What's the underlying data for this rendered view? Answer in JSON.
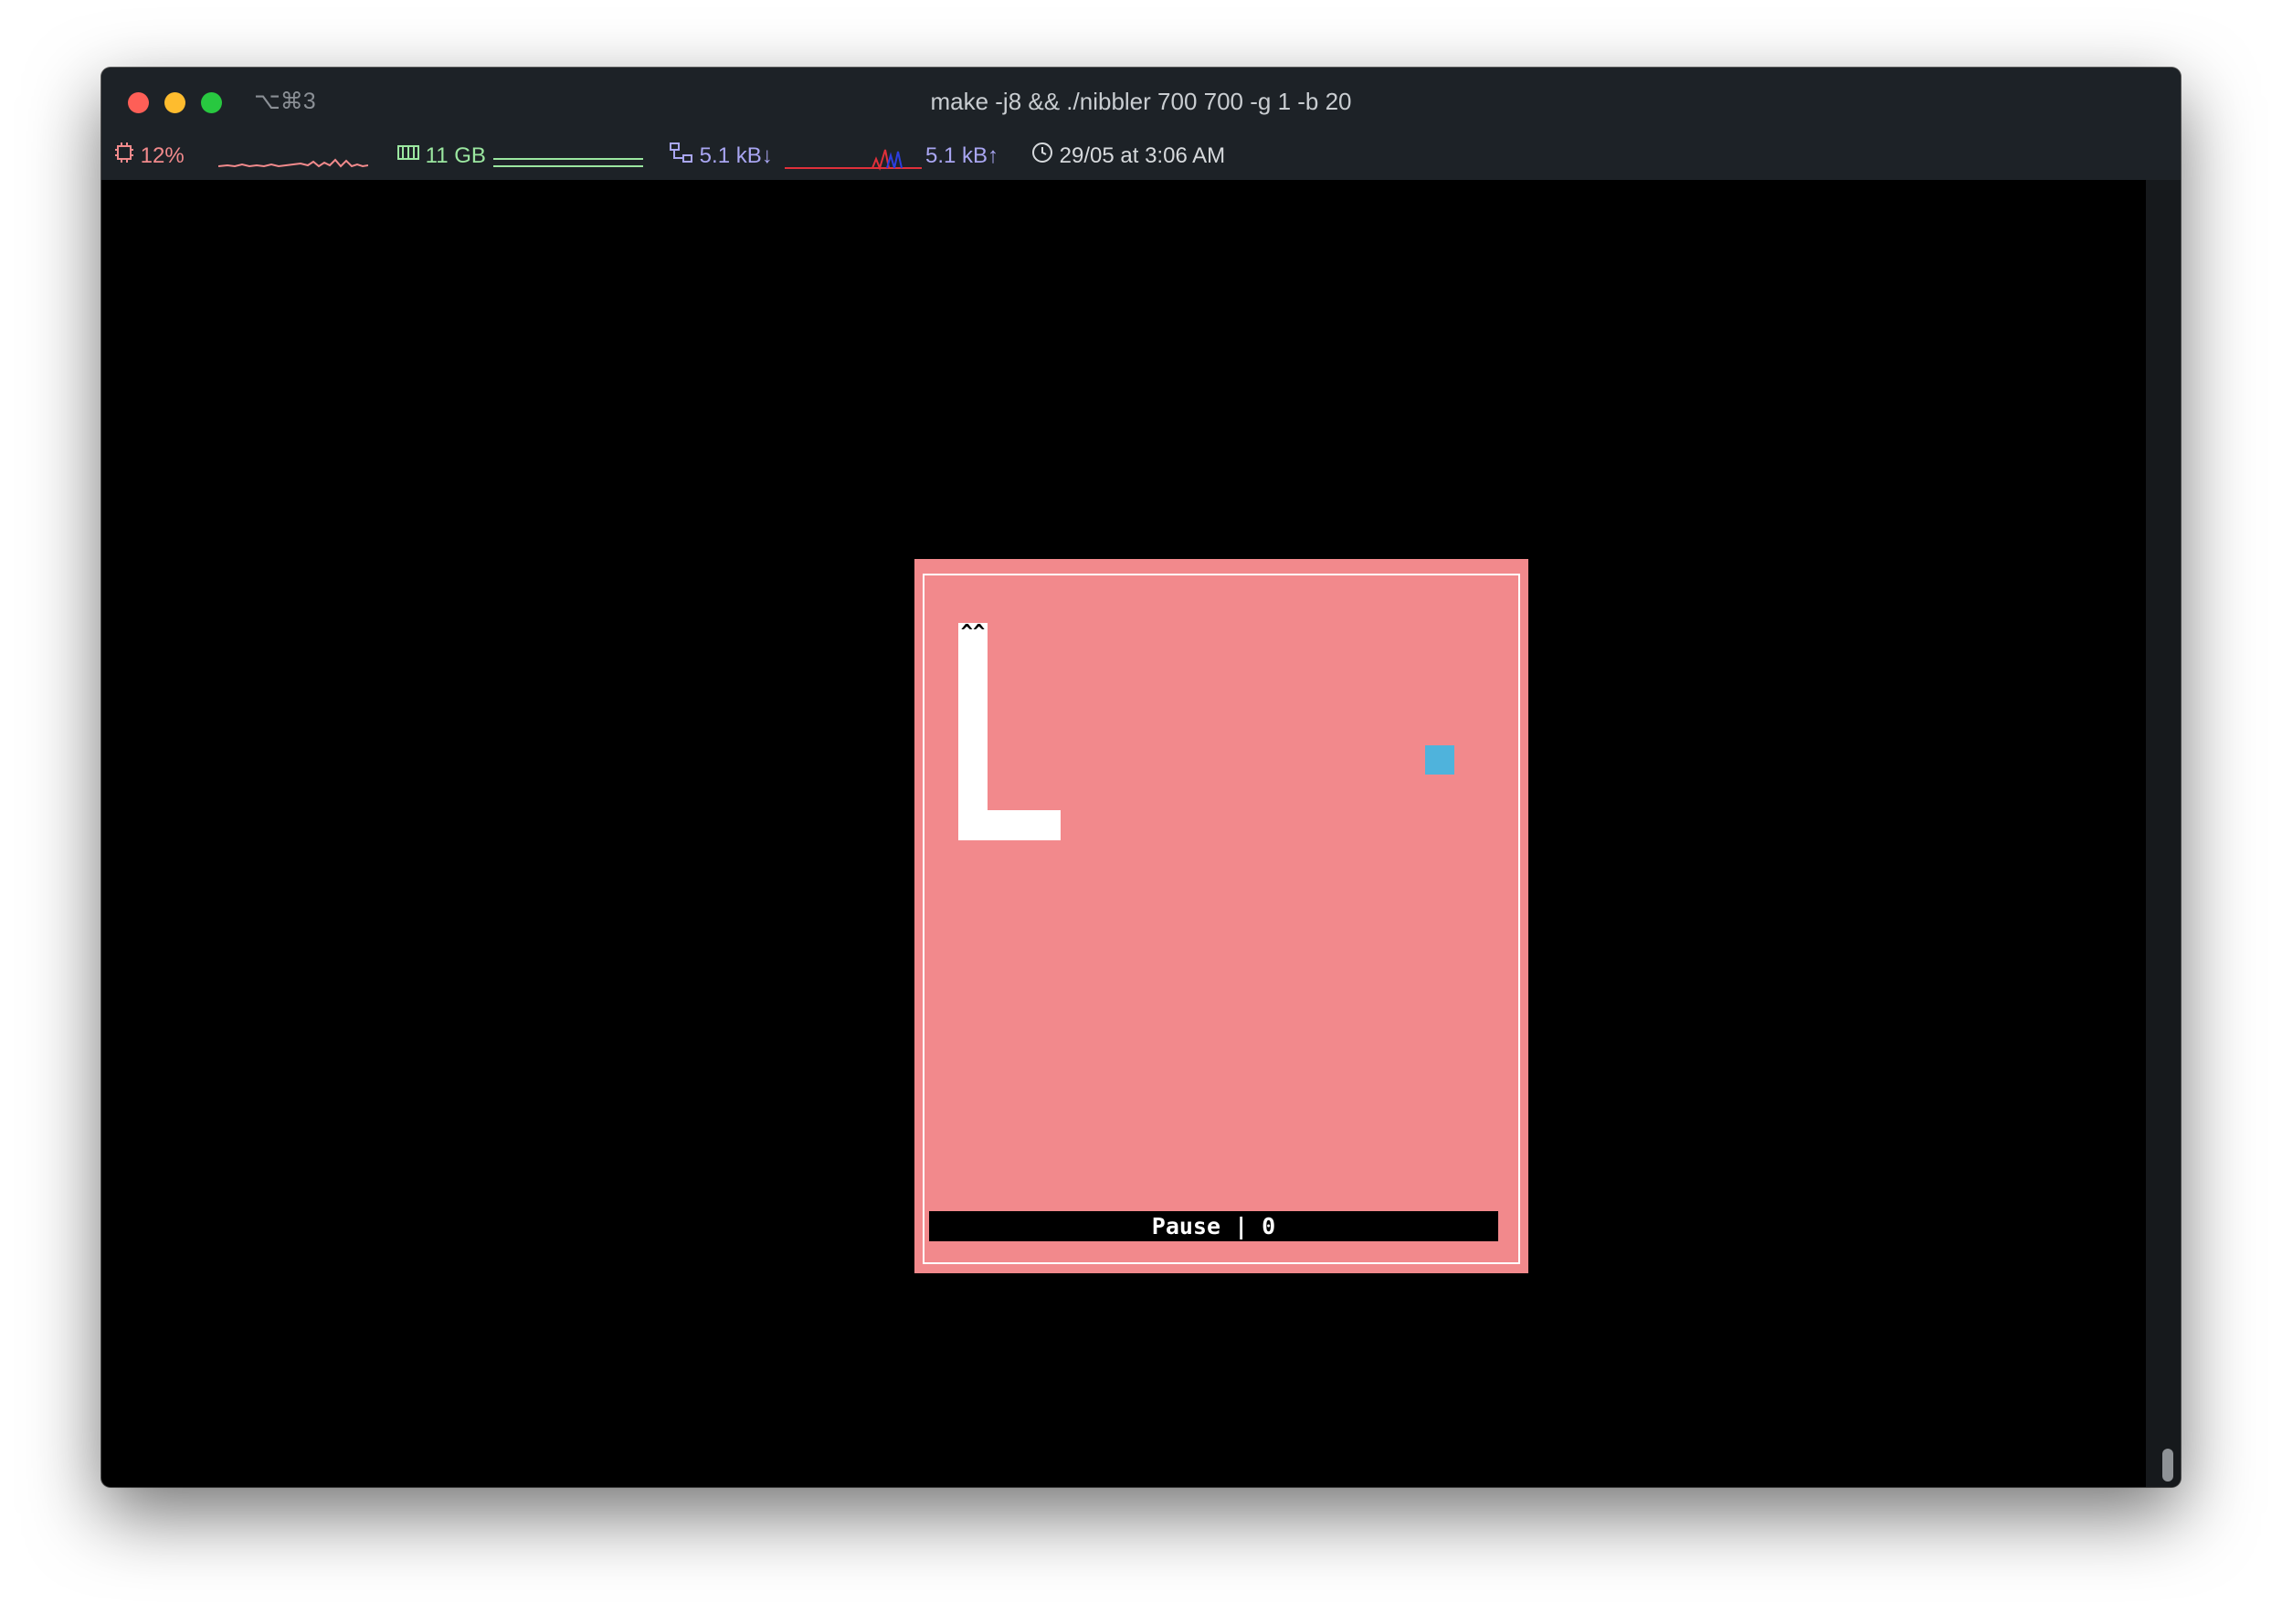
{
  "window": {
    "title": "make -j8 && ./nibbler 700 700 -g 1 -b 20",
    "shortcut": "⌥⌘3"
  },
  "statusbar": {
    "cpu": "12%",
    "memory": "11 GB",
    "net_down": "5.1 kB↓",
    "net_up": "5.1 kB↑",
    "clock": "29/05 at 3:06 AM",
    "icons": [
      "cpu-icon",
      "memory-icon",
      "network-icon",
      "clock-icon"
    ],
    "colors": {
      "cpu": "#f28a8c",
      "memory": "#9be7a0",
      "network": "#a9a6f2",
      "clock": "#d6d9dc"
    }
  },
  "game": {
    "background": "#f2898c",
    "snake_head": "^^",
    "snake_color": "#ffffff",
    "food_color": "#4fb3dc",
    "status_text": "Pause | 0"
  }
}
